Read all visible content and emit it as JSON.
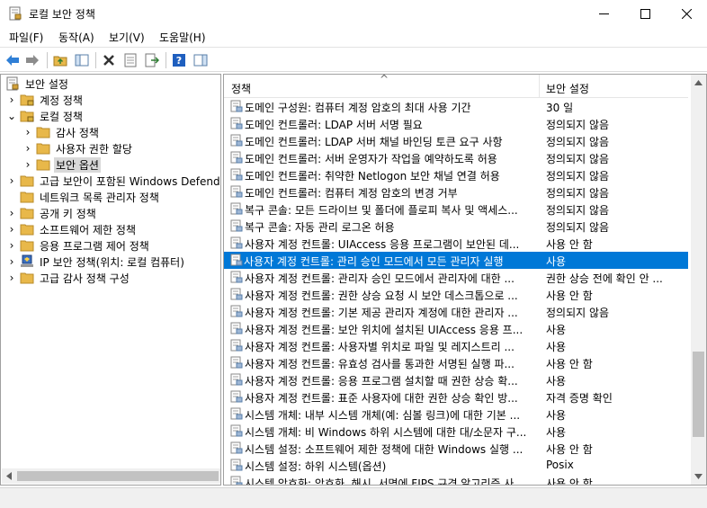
{
  "window": {
    "title": "로컬 보안 정책"
  },
  "menu": [
    {
      "label": "파일(F)"
    },
    {
      "label": "동작(A)"
    },
    {
      "label": "보기(V)"
    },
    {
      "label": "도움말(H)"
    }
  ],
  "tree": [
    {
      "label": "보안 설정",
      "expander": "",
      "icon": "security-settings-icon"
    },
    {
      "label": "계정 정책",
      "expander": "›",
      "icon": "folder-lock-icon"
    },
    {
      "label": "로컬 정책",
      "expander": "⌄",
      "icon": "folder-lock-icon"
    },
    {
      "label": "감사 정책",
      "expander": "›",
      "icon": "folder-icon"
    },
    {
      "label": "사용자 권한 할당",
      "expander": "›",
      "icon": "folder-icon"
    },
    {
      "label": "보안 옵션",
      "expander": "›",
      "icon": "folder-icon"
    },
    {
      "label": "고급 보안이 포함된 Windows Defend",
      "expander": "›",
      "icon": "folder-icon"
    },
    {
      "label": "네트워크 목록 관리자 정책",
      "expander": "",
      "icon": "folder-icon"
    },
    {
      "label": "공개 키 정책",
      "expander": "›",
      "icon": "folder-icon"
    },
    {
      "label": "소프트웨어 제한 정책",
      "expander": "›",
      "icon": "folder-icon"
    },
    {
      "label": "응용 프로그램 제어 정책",
      "expander": "›",
      "icon": "folder-icon"
    },
    {
      "label": "IP 보안 정책(위치: 로컬 컴퓨터)",
      "expander": "›",
      "icon": "ip-security-icon"
    },
    {
      "label": "고급 감사 정책 구성",
      "expander": "›",
      "icon": "folder-icon"
    }
  ],
  "list": {
    "col_policy": "정책",
    "col_setting": "보안 설정",
    "sort_glyph": "^",
    "rows": [
      {
        "policy": "도메인 구성원: 컴퓨터 계정 암호의 최대 사용 기간",
        "setting": "30 일"
      },
      {
        "policy": "도메인 컨트롤러: LDAP 서버 서명 필요",
        "setting": "정의되지 않음"
      },
      {
        "policy": "도메인 컨트롤러: LDAP 서버 채널 바인딩 토큰 요구 사항",
        "setting": "정의되지 않음"
      },
      {
        "policy": "도메인 컨트롤러: 서버 운영자가 작업을 예약하도록 허용",
        "setting": "정의되지 않음"
      },
      {
        "policy": "도메인 컨트롤러: 취약한 Netlogon 보안 채널 연결 허용",
        "setting": "정의되지 않음"
      },
      {
        "policy": "도메인 컨트롤러: 컴퓨터 계정 암호의 변경 거부",
        "setting": "정의되지 않음"
      },
      {
        "policy": "복구 콘솔: 모든 드라이브 및 폴더에 플로피 복사 및 액세스...",
        "setting": "정의되지 않음"
      },
      {
        "policy": "복구 콘솔: 자동 관리 로그온 허용",
        "setting": "정의되지 않음"
      },
      {
        "policy": "사용자 계정 컨트롤: UIAccess 응용 프로그램이 보안된 데...",
        "setting": "사용 안 함"
      },
      {
        "policy": "사용자 계정 컨트롤: 관리 승인 모드에서 모든 관리자 실행",
        "setting": "사용"
      },
      {
        "policy": "사용자 계정 컨트롤: 관리자 승인 모드에서 관리자에 대한 ...",
        "setting": "권한 상승 전에 확인 안 ..."
      },
      {
        "policy": "사용자 계정 컨트롤: 권한 상승 요청 시 보안 데스크톱으로 ...",
        "setting": "사용 안 함"
      },
      {
        "policy": "사용자 계정 컨트롤: 기본 제공 관리자 계정에 대한 관리자 ...",
        "setting": "정의되지 않음"
      },
      {
        "policy": "사용자 계정 컨트롤: 보안 위치에 설치된 UIAccess 응용 프...",
        "setting": "사용"
      },
      {
        "policy": "사용자 계정 컨트롤: 사용자별 위치로 파일 및 레지스트리 ...",
        "setting": "사용"
      },
      {
        "policy": "사용자 계정 컨트롤: 유효성 검사를 통과한 서명된 실행 파...",
        "setting": "사용 안 함"
      },
      {
        "policy": "사용자 계정 컨트롤: 응용 프로그램 설치할 때 권한 상승 확...",
        "setting": "사용"
      },
      {
        "policy": "사용자 계정 컨트롤: 표준 사용자에 대한 권한 상승 확인 방...",
        "setting": "자격 증명 확인"
      },
      {
        "policy": "시스템 개체: 내부 시스템 개체(예: 심볼 링크)에 대한 기본 ...",
        "setting": "사용"
      },
      {
        "policy": "시스템 개체: 비 Windows 하위 시스템에 대한 대/소문자 구...",
        "setting": "사용"
      },
      {
        "policy": "시스템 설정: 소프트웨어 제한 정책에 대한 Windows 실행 ...",
        "setting": "사용 안 함"
      },
      {
        "policy": "시스템 설정: 하위 시스템(옵션)",
        "setting": "Posix"
      },
      {
        "policy": "시스템 암호화: 암호화, 해시, 서명에 FIPS 규격 알고리즘 사...",
        "setting": "사용 안 함"
      }
    ]
  },
  "colors": {
    "selection": "#0078d7",
    "folder": "#e8b84a",
    "selected_tree": "#d9d9d9"
  }
}
